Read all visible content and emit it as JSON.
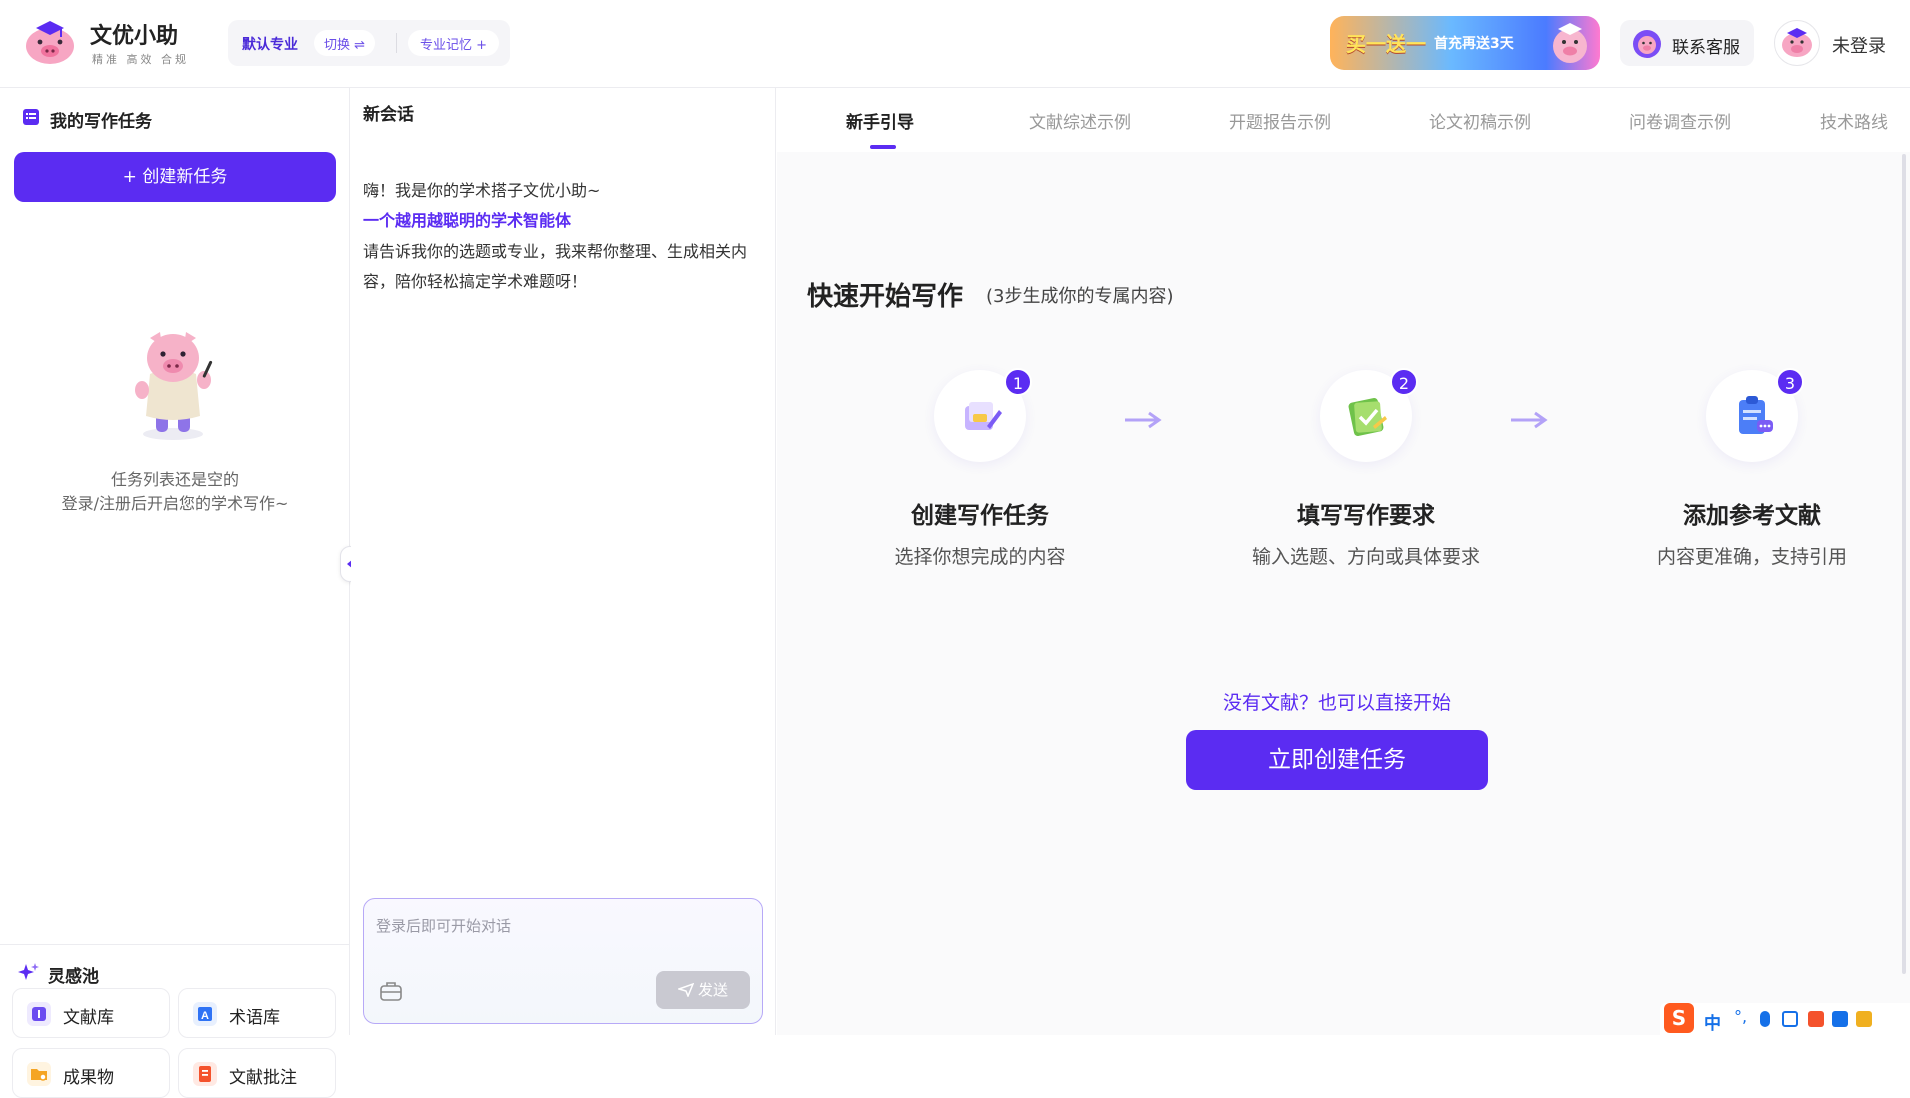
{
  "header": {
    "brand_title": "文优小助",
    "brand_sub": "精准 高效 合规",
    "mode_default": "默认专业",
    "mode_switch": "切换 ⇌",
    "mode_memory": "专业记忆 +",
    "promo_big": "买一送一",
    "promo_small": "首充再送3天",
    "support_label": "联系客服",
    "login_label": "未登录"
  },
  "sidebar": {
    "title": "我的写作任务",
    "create_label": "+  创建新任务",
    "empty_line1": "任务列表还是空的",
    "empty_line2": "登录/注册后开启您的学术写作~",
    "inspiration_title": "灵感池",
    "tools": [
      {
        "label": "文献库",
        "color": "#6b4cf0"
      },
      {
        "label": "术语库",
        "color": "#2f73f5"
      },
      {
        "label": "成果物",
        "color": "#f5a524"
      },
      {
        "label": "文献批注",
        "color": "#f4522c"
      }
    ]
  },
  "chat": {
    "title": "新会话",
    "greeting": "嗨！我是你的学术搭子文优小助~",
    "tagline": "一个越用越聪明的学术智能体",
    "intro": "请告诉我你的选题或专业，我来帮你整理、生成相关内容，陪你轻松搞定学术难题呀！",
    "placeholder": "登录后即可开始对话",
    "send_label": "发送"
  },
  "main": {
    "tabs": [
      {
        "label": "新手引导",
        "active": true
      },
      {
        "label": "文献综述示例",
        "active": false
      },
      {
        "label": "开题报告示例",
        "active": false
      },
      {
        "label": "论文初稿示例",
        "active": false
      },
      {
        "label": "问卷调查示例",
        "active": false
      },
      {
        "label": "技术路线",
        "active": false
      }
    ],
    "quickstart_title": "快速开始写作",
    "quickstart_sub": "(3步生成你的专属内容)",
    "steps": [
      {
        "num": "1",
        "title": "创建写作任务",
        "desc": "选择你想完成的内容"
      },
      {
        "num": "2",
        "title": "填写写作要求",
        "desc": "输入选题、方向或具体要求"
      },
      {
        "num": "3",
        "title": "添加参考文献",
        "desc": "内容更准确，支持引用"
      }
    ],
    "no_doc_label": "没有文献？也可以直接开始",
    "start_label": "立即创建任务"
  },
  "ime": {
    "s_label": "S",
    "zh_label": "中",
    "dot_label": "°,"
  },
  "colors": {
    "accent": "#5b2cf2",
    "accent_light": "#b7a9f7"
  }
}
